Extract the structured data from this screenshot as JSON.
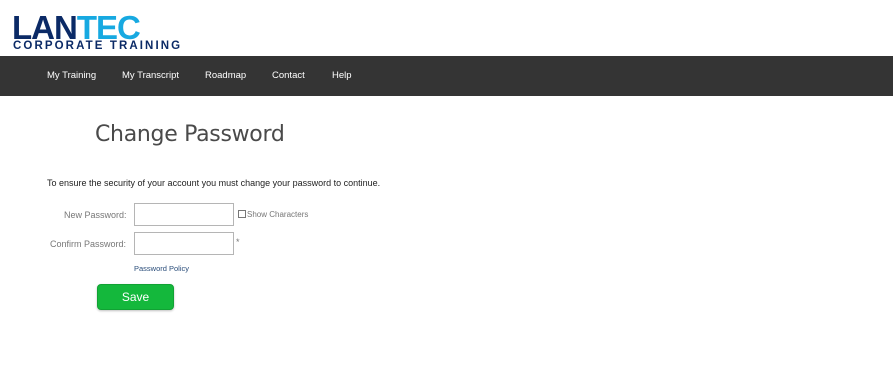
{
  "logo": {
    "word_part1": "LAN",
    "word_part2": "TEC",
    "tagline": "CORPORATE TRAINING"
  },
  "nav": {
    "items": [
      {
        "label": "My Training"
      },
      {
        "label": "My Transcript"
      },
      {
        "label": "Roadmap"
      },
      {
        "label": "Contact"
      },
      {
        "label": "Help"
      }
    ]
  },
  "main": {
    "title": "Change Password",
    "notice": "To ensure the security of your account you must change your password to continue.",
    "new_password_label": "New Password:",
    "confirm_password_label": "Confirm Password:",
    "show_characters_label": "Show Characters",
    "required_mark": "*",
    "policy_link": "Password Policy",
    "save_label": "Save"
  },
  "colors": {
    "navbar_bg": "#343434",
    "brand_dark": "#0b2a66",
    "brand_light": "#17a9e1",
    "save_green": "#14b83c"
  }
}
